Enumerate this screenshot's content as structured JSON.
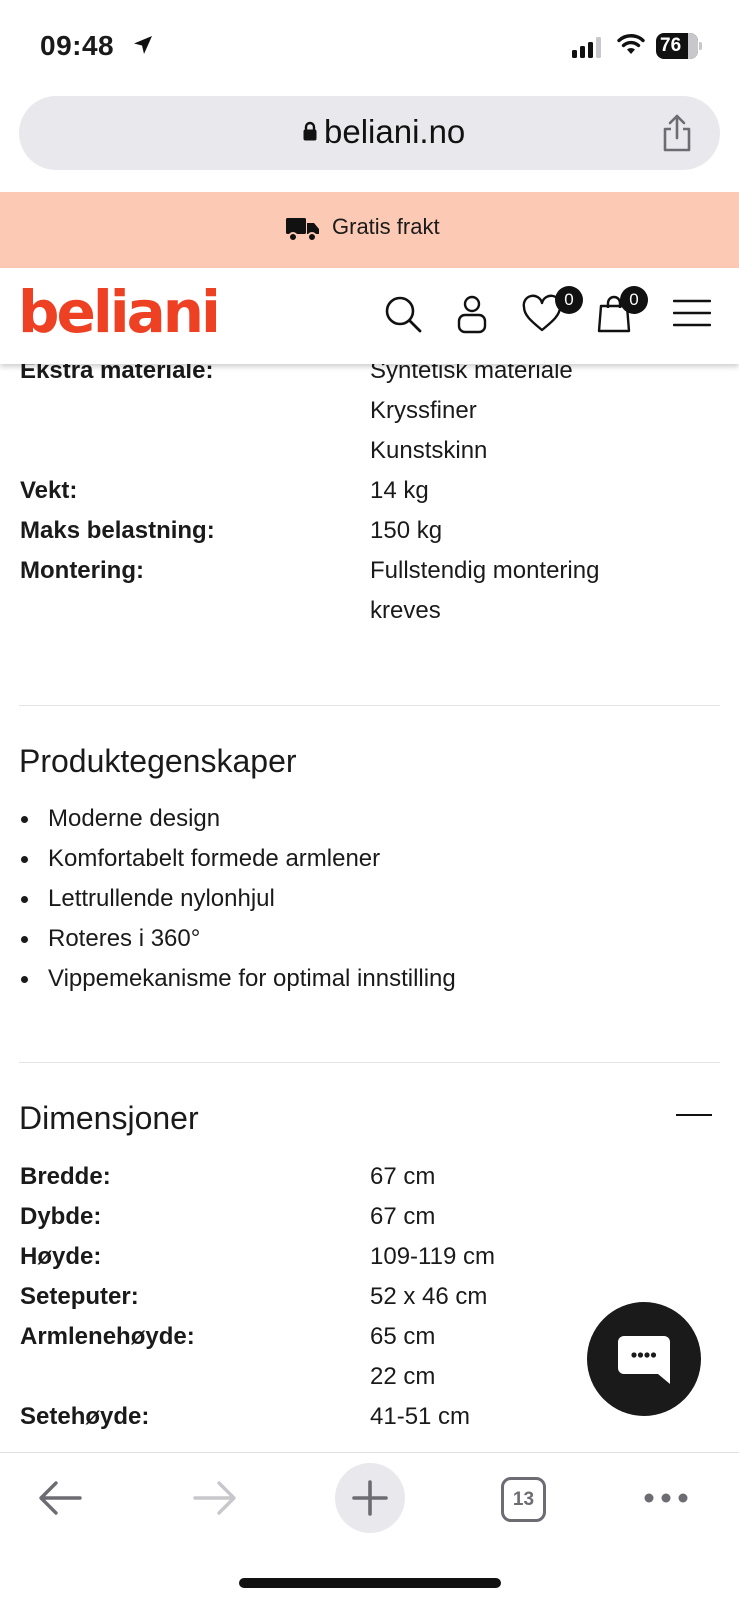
{
  "status_bar": {
    "time": "09:48",
    "battery": "76"
  },
  "browser": {
    "url": "beliani.no",
    "tabs_count": "13"
  },
  "promo": {
    "text": "Gratis frakt"
  },
  "header": {
    "logo": "beliani",
    "wishlist_count": "0",
    "cart_count": "0"
  },
  "specs": [
    {
      "label": "Ekstra materiale:",
      "values": [
        "Syntetisk materiale",
        "Kryssfiner",
        "Kunstskinn"
      ]
    },
    {
      "label": "Vekt:",
      "values": [
        "14 kg"
      ]
    },
    {
      "label": "Maks belastning:",
      "values": [
        "150 kg"
      ]
    },
    {
      "label": "Montering:",
      "values": [
        "Fullstendig montering",
        "kreves"
      ]
    }
  ],
  "features": {
    "title": "Produktegenskaper",
    "items": [
      "Moderne design",
      "Komfortabelt formede armlener",
      "Lettrullende nylonhjul",
      "Roteres i 360°",
      "Vippemekanisme for optimal innstilling"
    ]
  },
  "dimensions": {
    "title": "Dimensjoner",
    "rows": [
      {
        "label": "Bredde:",
        "values": [
          "67 cm"
        ]
      },
      {
        "label": "Dybde:",
        "values": [
          "67 cm"
        ]
      },
      {
        "label": "Høyde:",
        "values": [
          "109-119 cm"
        ]
      },
      {
        "label": "Seteputer:",
        "values": [
          "52 x 46 cm"
        ]
      },
      {
        "label": "Armlenehøyde:",
        "values": [
          "65 cm",
          "22 cm"
        ]
      },
      {
        "label": "Setehøyde:",
        "values": [
          "41-51 cm"
        ]
      }
    ]
  },
  "colors": {
    "brand": "#ee4124",
    "promo_bg": "#fcc9b4",
    "text": "#1a1a1a"
  },
  "icons": [
    "location-arrow-icon",
    "signal-icon",
    "wifi-icon",
    "battery-icon",
    "lock-icon",
    "share-icon",
    "truck-icon",
    "search-icon",
    "user-icon",
    "heart-icon",
    "bag-icon",
    "menu-icon",
    "minus-icon",
    "chat-icon",
    "back-icon",
    "forward-icon",
    "plus-icon",
    "tabs-icon",
    "more-icon"
  ]
}
